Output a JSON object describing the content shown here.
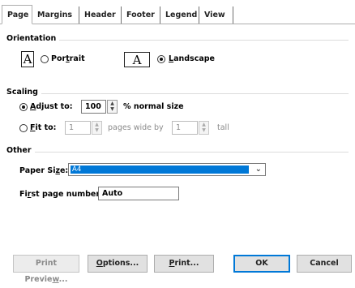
{
  "tabs": [
    "Page",
    "Margins",
    "Header",
    "Footer",
    "Legend",
    "View"
  ],
  "orientation": {
    "label": "Orientation",
    "portrait_icon_glyph": "A",
    "landscape_icon_glyph": "A",
    "portrait_pre": "Por",
    "portrait_u": "t",
    "portrait_post": "rait",
    "landscape_u": "L",
    "landscape_post": "andscape",
    "selected": "Landscape"
  },
  "scaling": {
    "label": "Scaling",
    "adjust_u": "A",
    "adjust_post": "djust to:",
    "adjust_value": "100",
    "adjust_suffix": "% normal size",
    "fit_u": "F",
    "fit_post": "it to:",
    "fit_wide_value": "1",
    "fit_wide_suffix": "pages wide by",
    "fit_tall_value": "1",
    "fit_tall_suffix": "tall",
    "selected": "Adjust to"
  },
  "other": {
    "label": "Other",
    "paper_size_pre": "Paper Si",
    "paper_size_u": "z",
    "paper_size_post": "e:",
    "paper_size_value": "A4",
    "first_page_pre": "Fi",
    "first_page_u": "r",
    "first_page_post": "st page number:",
    "first_page_value": "Auto"
  },
  "buttons": {
    "print_preview_pre": "Print Previe",
    "print_preview_u": "w",
    "print_preview_post": "...",
    "options_u": "O",
    "options_post": "ptions...",
    "print_u": "P",
    "print_post": "rint...",
    "ok": "OK",
    "cancel": "Cancel"
  },
  "icons": {
    "spin_up": "▲",
    "spin_down": "▼",
    "dropdown_arrow": "⌄"
  },
  "colors": {
    "selection": "#0078d7",
    "tab_border": "#adadad",
    "disabled_text": "#8a8a8a"
  }
}
